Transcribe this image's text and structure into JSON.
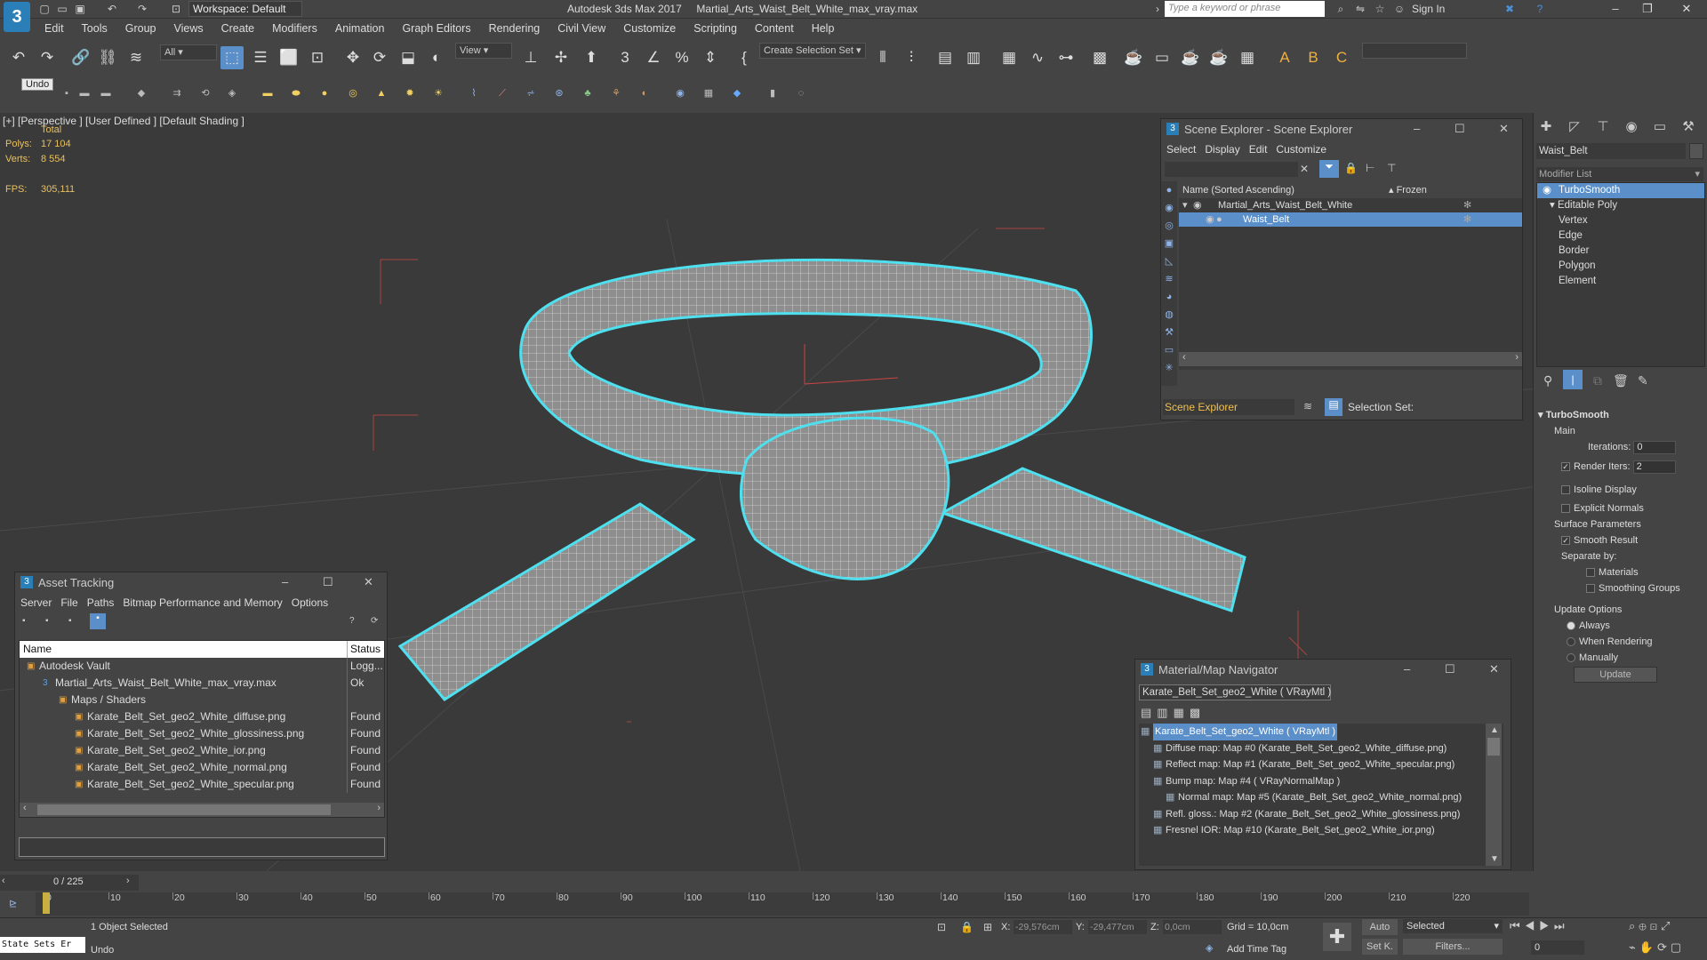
{
  "app": {
    "title": "Autodesk 3ds Max 2017",
    "file": "Martial_Arts_Waist_Belt_White_max_vray.max",
    "workspace": "Workspace: Default",
    "search_placeholder": "Type a keyword or phrase",
    "sign_in": "Sign In",
    "logo": "3"
  },
  "menu": [
    "Edit",
    "Tools",
    "Group",
    "Views",
    "Create",
    "Modifiers",
    "Animation",
    "Graph Editors",
    "Rendering",
    "Civil View",
    "Customize",
    "Scripting",
    "Content",
    "Help"
  ],
  "toolbar": {
    "filter_all": "All",
    "ref_coord": "View",
    "selection_set": "Create Selection Set",
    "undo_tooltip": "Undo"
  },
  "viewport": {
    "label": "[+] [Perspective ]  [User Defined ]  [Default Shading ]",
    "total_label": "Total",
    "polys_label": "Polys:",
    "polys_value": "17 104",
    "verts_label": "Verts:",
    "verts_value": "8 554",
    "fps_label": "FPS:",
    "fps_value": "305,111"
  },
  "scene_explorer": {
    "title": "Scene Explorer - Scene Explorer",
    "menu": [
      "Select",
      "Display",
      "Edit",
      "Customize"
    ],
    "col_name": "Name (Sorted Ascending)",
    "col_frozen": "▴ Frozen",
    "rows": [
      {
        "name": "Martial_Arts_Waist_Belt_White",
        "selected": false
      },
      {
        "name": "Waist_Belt",
        "selected": true
      }
    ],
    "footer_label": "Scene Explorer",
    "selection_set_label": "Selection Set:"
  },
  "asset_tracking": {
    "title": "Asset Tracking",
    "menu": [
      "Server",
      "File",
      "Paths",
      "Bitmap Performance and Memory",
      "Options"
    ],
    "col_name": "Name",
    "col_status": "Status",
    "rows": [
      {
        "name": "Autodesk Vault",
        "status": "Logg..."
      },
      {
        "name": "Martial_Arts_Waist_Belt_White_max_vray.max",
        "status": "Ok"
      },
      {
        "name": "Maps / Shaders",
        "status": ""
      },
      {
        "name": "Karate_Belt_Set_geo2_White_diffuse.png",
        "status": "Found"
      },
      {
        "name": "Karate_Belt_Set_geo2_White_glossiness.png",
        "status": "Found"
      },
      {
        "name": "Karate_Belt_Set_geo2_White_ior.png",
        "status": "Found"
      },
      {
        "name": "Karate_Belt_Set_geo2_White_normal.png",
        "status": "Found"
      },
      {
        "name": "Karate_Belt_Set_geo2_White_specular.png",
        "status": "Found"
      }
    ]
  },
  "material_navigator": {
    "title": "Material/Map Navigator",
    "current": "Karate_Belt_Set_geo2_White  ( VRayMtl )",
    "rows": [
      {
        "text": "Karate_Belt_Set_geo2_White  ( VRayMtl )",
        "selected": true
      },
      {
        "text": "Diffuse map: Map #0 (Karate_Belt_Set_geo2_White_diffuse.png)",
        "selected": false
      },
      {
        "text": "Reflect map: Map #1 (Karate_Belt_Set_geo2_White_specular.png)",
        "selected": false
      },
      {
        "text": "Bump map: Map #4  ( VRayNormalMap )",
        "selected": false
      },
      {
        "text": "Normal map: Map #5 (Karate_Belt_Set_geo2_White_normal.png)",
        "selected": false
      },
      {
        "text": "Refl. gloss.: Map #2 (Karate_Belt_Set_geo2_White_glossiness.png)",
        "selected": false
      },
      {
        "text": "Fresnel IOR: Map #10 (Karate_Belt_Set_geo2_White_ior.png)",
        "selected": false
      }
    ]
  },
  "command_panel": {
    "object_name": "Waist_Belt",
    "modifier_list": "Modifier List",
    "stack": [
      {
        "name": "TurboSmooth",
        "selected": true
      },
      {
        "name": "Editable Poly",
        "selected": false
      },
      {
        "name": "Vertex",
        "selected": false
      },
      {
        "name": "Edge",
        "selected": false
      },
      {
        "name": "Border",
        "selected": false
      },
      {
        "name": "Polygon",
        "selected": false
      },
      {
        "name": "Element",
        "selected": false
      }
    ],
    "turbosmooth": {
      "header": "TurboSmooth",
      "main": "Main",
      "iterations_label": "Iterations:",
      "iterations_value": "0",
      "render_iters_label": "Render Iters:",
      "render_iters_value": "2",
      "isoline": "Isoline Display",
      "explicit_normals": "Explicit Normals",
      "surface_params": "Surface Parameters",
      "smooth_result": "Smooth Result",
      "separate_by": "Separate by:",
      "materials": "Materials",
      "smoothing_groups": "Smoothing Groups",
      "update_options": "Update Options",
      "always": "Always",
      "when_rendering": "When Rendering",
      "manually": "Manually",
      "update_button": "Update"
    }
  },
  "timeline": {
    "frame_display": "0 / 225",
    "ticks": [
      "0",
      "10",
      "20",
      "30",
      "40",
      "50",
      "60",
      "70",
      "80",
      "90",
      "100",
      "110",
      "120",
      "130",
      "140",
      "150",
      "160",
      "170",
      "180",
      "190",
      "200",
      "210",
      "220"
    ]
  },
  "status": {
    "script_listener": "State Sets Er",
    "selected": "1 Object Selected",
    "prompt": "Undo",
    "x_label": "X:",
    "x_value": "-29,576cm",
    "y_label": "Y:",
    "y_value": "-29,477cm",
    "z_label": "Z:",
    "z_value": "0,0cm",
    "grid": "Grid = 10,0cm",
    "add_time_tag": "Add Time Tag",
    "auto": "Auto",
    "set_k": "Set K.",
    "selected_dropdown": "Selected",
    "filters": "Filters...",
    "frame_value": "0"
  },
  "colors": {
    "selection_blue": "#5a8fc9",
    "wire_cyan": "#4fe0ef",
    "app_blue": "#2a7fb8"
  }
}
